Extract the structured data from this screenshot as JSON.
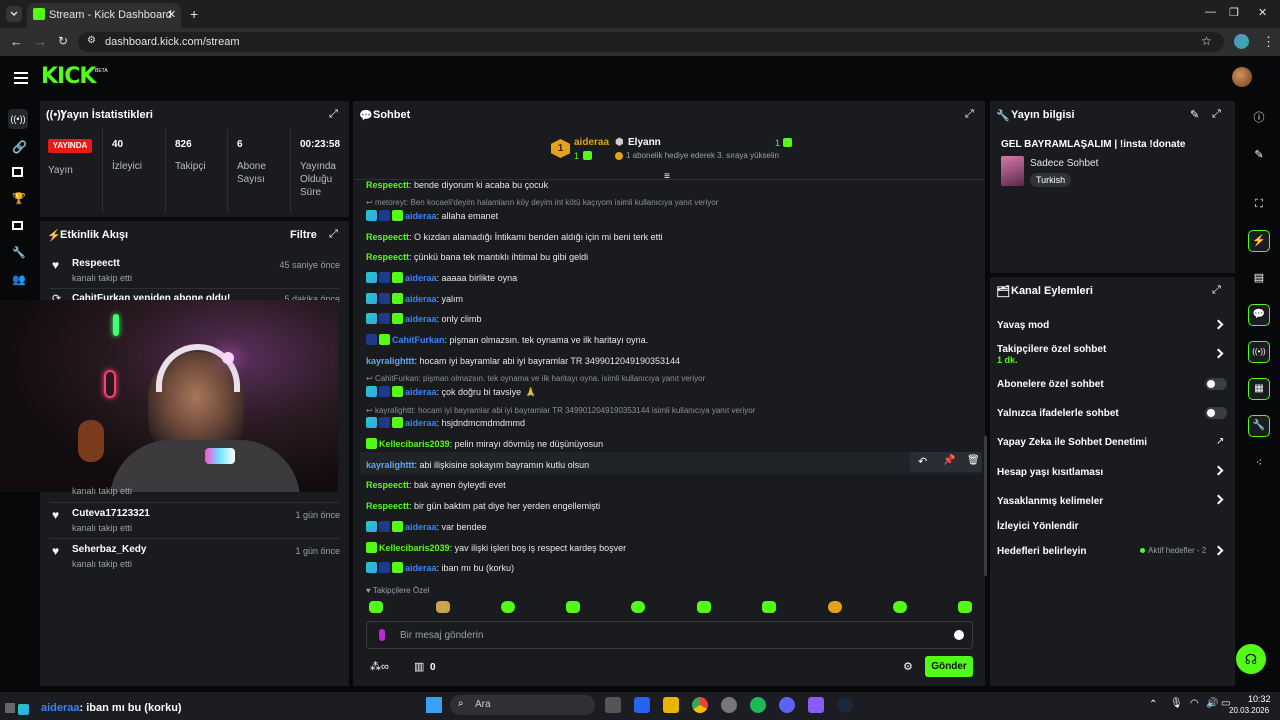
{
  "browser": {
    "tab_title": "Stream - Kick Dashboard",
    "url": "dashboard.kick.com/stream"
  },
  "logo": {
    "text": "KICK",
    "beta": "BETA"
  },
  "stats": {
    "title": "Yayın İstatistikleri",
    "live_badge": "YAYINDA",
    "live_label": "Yayın",
    "viewers_value": "40",
    "viewers_label": "İzleyici",
    "followers_value": "826",
    "followers_label": "Takipçi",
    "subs_value": "6",
    "subs_label": "Abone Sayısı",
    "duration_value": "00:23:58",
    "duration_label": "Yayında Olduğu Süre"
  },
  "activity": {
    "title": "Etkinlik Akışı",
    "filter": "Filtre",
    "items": [
      {
        "name": "Respeectt",
        "action": "kanalı takip etti",
        "time": "45 saniye önce"
      },
      {
        "name": "CahitFurkan yeniden abone oldu!",
        "action": "",
        "time": "5 dakika önce"
      },
      {
        "name": "Cuteva17123321",
        "action": "kanalı takip etti",
        "time": "1 gün önce"
      },
      {
        "name": "Seherbaz_Kedy",
        "action": "kanalı takip etti",
        "time": "1 gün önce"
      }
    ],
    "partial": "kanalı takip etti"
  },
  "chat": {
    "title": "Sohbet",
    "top_gifter": "aideraa",
    "top_gifter_count": "1",
    "rank_count": "1",
    "gift_user": "Elyann",
    "gift_text": "1 abonelik hediye ederek 3. sıraya yükselin",
    "messages": [
      {
        "user": "Respeectt",
        "text": ": bende diyorum ki acaba bu çocuk",
        "color": "#53fc18"
      },
      {
        "reply": "metoreyt: Ben kocaeli'deyim halamların köy deyim int kötü kaçıyom isimli kullanıcıya yanıt veriyor"
      },
      {
        "user": "aideraa",
        "text": ": allaha emanet",
        "color": "#3b82f6",
        "badges": true
      },
      {
        "user": "Respeectt",
        "text": ": O kızdan alamadığı İntikamı benden aldığı için mi beni terk etti",
        "color": "#53fc18"
      },
      {
        "user": "Respeectt",
        "text": ": çünkü bana tek mantıklı ihtimal bu gibi geldi",
        "color": "#53fc18"
      },
      {
        "user": "aideraa",
        "text": ": aaaaa birlikte oyna",
        "color": "#3b82f6",
        "badges": true
      },
      {
        "user": "aideraa",
        "text": ": yalım",
        "color": "#3b82f6",
        "badges": true
      },
      {
        "user": "aideraa",
        "text": ": only climb",
        "color": "#3b82f6",
        "badges": true
      },
      {
        "user": "CahitFurkan",
        "text": ": pişman olmazsın. tek oynama ve ilk haritayı oyna.",
        "color": "#3b82f6",
        "badges": "b2"
      },
      {
        "user": "kayralighttt",
        "text": ": hocam iyi bayramlar abi iyi bayramlar TR 3499012049190353144",
        "color": "#60a5fa"
      },
      {
        "reply": "CahitFurkan: pişman olmazsın. tek oynama ve ilk haritayı oyna. isimli kullanıcıya yanıt veriyor"
      },
      {
        "user": "aideraa",
        "text": ": çok doğru bi tavsiye",
        "color": "#3b82f6",
        "badges": true
      },
      {
        "reply": "kayralighttt: hocam iyi bayramlar abi iyi bayramlar TR 3499012049190353144 isimli kullanıcıya yanıt veriyor"
      },
      {
        "user": "aideraa",
        "text": ": hsjdndmcmdmdmmd",
        "color": "#3b82f6",
        "badges": true
      },
      {
        "user": "Kellecibaris2039",
        "text": ": pelin mirayı dövmüş ne düşünüyosun",
        "color": "#53fc18",
        "badges": "b3"
      },
      {
        "user": "kayralighttt",
        "text": ": abi ilişkisine sokayım bayramın kutlu olsun",
        "color": "#60a5fa"
      },
      {
        "user": "Respeectt",
        "text": ": bak aynen öyleydi evet",
        "color": "#53fc18"
      },
      {
        "user": "Respeectt",
        "text": ": bir gün baktim pat diye her yerden engellemişti",
        "color": "#53fc18"
      },
      {
        "user": "aideraa",
        "text": ": var bendee",
        "color": "#3b82f6",
        "badges": true
      },
      {
        "user": "Kellecibaris2039",
        "text": ": yav ilişki işleri boş iş respect kardeş boşver",
        "color": "#53fc18",
        "badges": "b3"
      },
      {
        "user": "aideraa",
        "text": ": iban mı bu (korku)",
        "color": "#3b82f6",
        "badges": true
      }
    ],
    "followers_only": "Takipçilere Özel",
    "input_placeholder": "Bir mesaj gönderin",
    "points": "0",
    "send": "Gönder"
  },
  "info": {
    "title": "Yayın bilgisi",
    "stream_title": "GEL BAYRAMLAŞALIM | !insta !donate",
    "category": "Sadece Sohbet",
    "language": "Turkish"
  },
  "actions": {
    "title": "Kanal Eylemleri",
    "slow_mode": "Yavaş mod",
    "followers_chat": "Takipçilere özel sohbet",
    "followers_chat_value": "1 dk.",
    "subs_chat": "Abonelere özel sohbet",
    "emote_chat": "Yalnızca ifadelerle sohbet",
    "ai_mod": "Yapay Zeka ile Sohbet Denetimi",
    "account_age": "Hesap yaşı kısıtlaması",
    "banned_words": "Yasaklanmış kelimeler",
    "raid": "İzleyici Yönlendir",
    "goals": "Hedefleri belirleyin",
    "goals_status": "Aktif hedefler - 2"
  },
  "taskbar": {
    "ticker_user": "aideraa",
    "ticker_text": ": iban mı bu (korku)",
    "search": "Ara",
    "time": "10:32",
    "date": "20.03.2026"
  },
  "colors": {
    "accent": "#53fc18",
    "panel": "#191b1f",
    "live": "#e91916"
  }
}
